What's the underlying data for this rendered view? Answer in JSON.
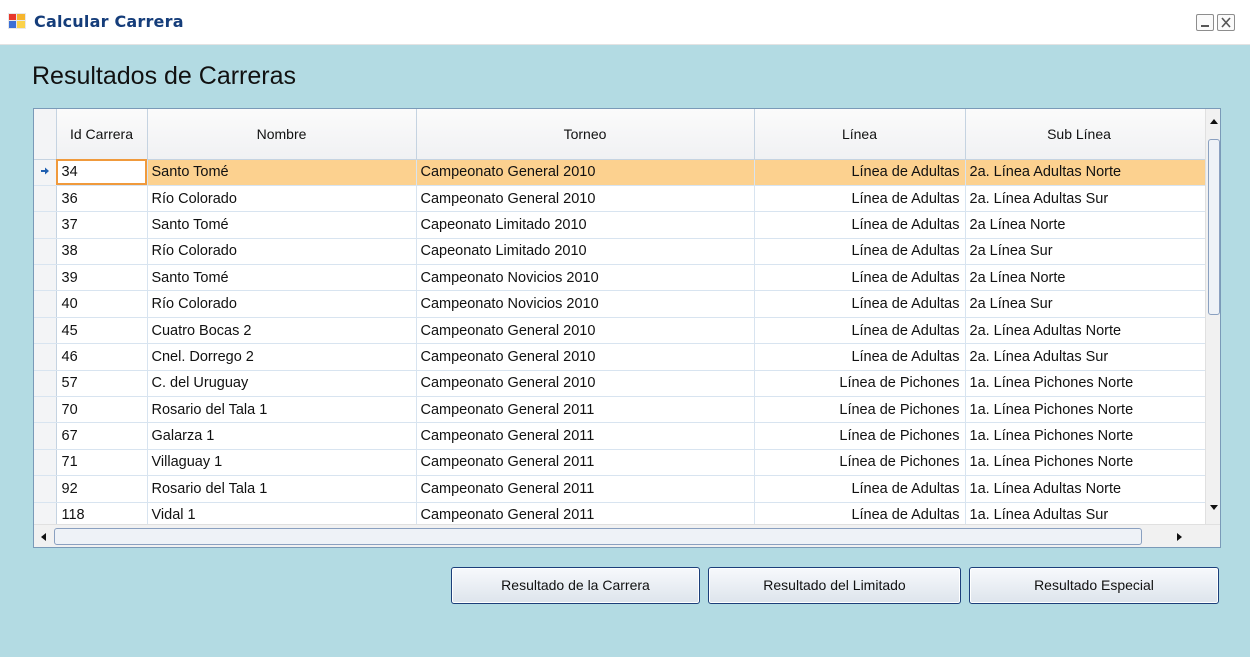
{
  "window": {
    "title": "Calcular Carrera",
    "minimize_icon": "minimize-icon",
    "close_icon": "close-icon"
  },
  "heading": "Resultados de Carreras",
  "grid": {
    "columns": [
      "Id Carrera",
      "Nombre",
      "Torneo",
      "Línea",
      "Sub Línea"
    ],
    "rows": [
      {
        "id": "34",
        "nombre": "Santo Tomé",
        "torneo": "Campeonato General 2010",
        "linea": "Línea de Adultas",
        "sublinea": "2a. Línea Adultas Norte"
      },
      {
        "id": "36",
        "nombre": "Río Colorado",
        "torneo": "Campeonato General 2010",
        "linea": "Línea de Adultas",
        "sublinea": "2a. Línea Adultas Sur"
      },
      {
        "id": "37",
        "nombre": "Santo Tomé",
        "torneo": "Capeonato Limitado 2010",
        "linea": "Línea de Adultas",
        "sublinea": "2a Línea Norte"
      },
      {
        "id": "38",
        "nombre": "Río Colorado",
        "torneo": "Capeonato Limitado 2010",
        "linea": "Línea de Adultas",
        "sublinea": "2a Línea Sur"
      },
      {
        "id": "39",
        "nombre": "Santo Tomé",
        "torneo": "Campeonato Novicios 2010",
        "linea": "Línea de Adultas",
        "sublinea": "2a Línea Norte"
      },
      {
        "id": "40",
        "nombre": "Río Colorado",
        "torneo": "Campeonato Novicios 2010",
        "linea": "Línea de Adultas",
        "sublinea": "2a Línea Sur"
      },
      {
        "id": "45",
        "nombre": "Cuatro Bocas 2",
        "torneo": "Campeonato General 2010",
        "linea": "Línea de Adultas",
        "sublinea": "2a. Línea Adultas Norte"
      },
      {
        "id": "46",
        "nombre": "Cnel. Dorrego 2",
        "torneo": "Campeonato General 2010",
        "linea": "Línea de Adultas",
        "sublinea": "2a. Línea Adultas Sur"
      },
      {
        "id": "57",
        "nombre": "C. del Uruguay",
        "torneo": "Campeonato General 2010",
        "linea": "Línea de Pichones",
        "sublinea": "1a. Línea Pichones Norte"
      },
      {
        "id": "70",
        "nombre": "Rosario del Tala 1",
        "torneo": "Campeonato General 2011",
        "linea": "Línea de Pichones",
        "sublinea": "1a. Línea Pichones Norte"
      },
      {
        "id": "67",
        "nombre": "Galarza 1",
        "torneo": "Campeonato General 2011",
        "linea": "Línea de Pichones",
        "sublinea": "1a. Línea Pichones Norte"
      },
      {
        "id": "71",
        "nombre": "Villaguay 1",
        "torneo": "Campeonato General 2011",
        "linea": "Línea de Pichones",
        "sublinea": "1a. Línea Pichones Norte"
      },
      {
        "id": "92",
        "nombre": "Rosario del Tala 1",
        "torneo": "Campeonato General 2011",
        "linea": "Línea de Adultas",
        "sublinea": "1a. Línea Adultas Norte"
      },
      {
        "id": "118",
        "nombre": "Vidal 1",
        "torneo": "Campeonato General 2011",
        "linea": "Línea de Adultas",
        "sublinea": "1a. Línea Adultas Sur"
      }
    ],
    "selected_row_index": 0,
    "row_indicator_icon": "row-pointer-icon"
  },
  "buttons": {
    "resultado_carrera": "Resultado de la Carrera",
    "resultado_limitado": "Resultado del Limitado",
    "resultado_especial": "Resultado Especial"
  },
  "colors": {
    "background": "#b3dbe3",
    "selection": "#fcd18f",
    "title": "#153d7a"
  }
}
